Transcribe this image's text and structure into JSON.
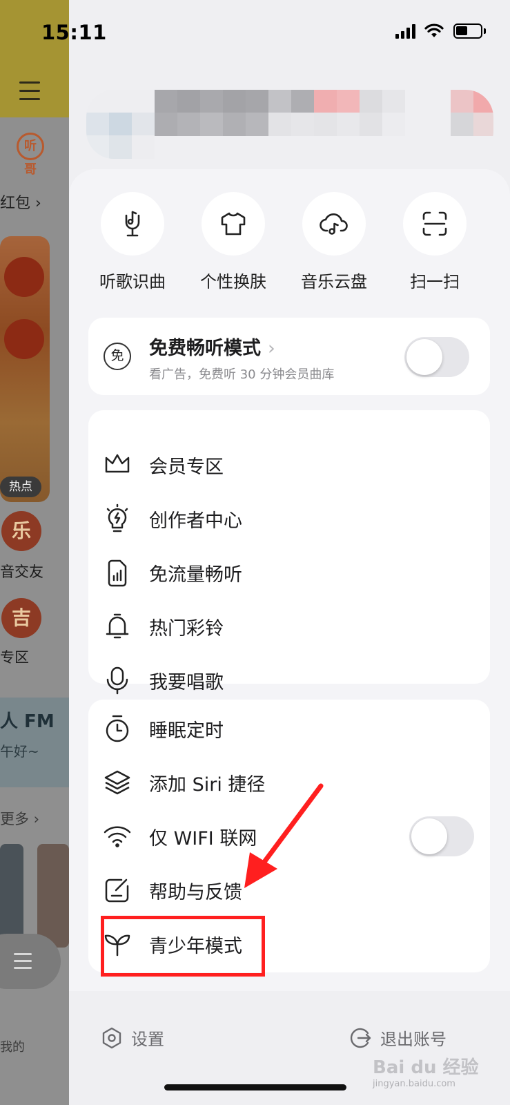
{
  "status_bar": {
    "time": "15:11"
  },
  "background_app": {
    "logo": "听哥",
    "red_packet": "红包",
    "hot_badge": "热点",
    "circle1": "乐",
    "label1": "音交友",
    "circle2": "吉",
    "label2": "专区",
    "fm_title": "人 FM",
    "fm_sub": "午好~",
    "more": "更多",
    "mine": "我的"
  },
  "quick_actions": [
    {
      "label": "听歌识曲",
      "icon": "mic-music-icon"
    },
    {
      "label": "个性换肤",
      "icon": "tshirt-icon"
    },
    {
      "label": "音乐云盘",
      "icon": "cloud-music-icon"
    },
    {
      "label": "扫一扫",
      "icon": "scan-icon"
    }
  ],
  "free_mode": {
    "badge": "免",
    "title": "免费畅听模式",
    "subtitle": "看广告，免费听 30 分钟会员曲库",
    "toggle_on": false
  },
  "menu_group1": [
    {
      "label": "会员专区",
      "icon": "crown-icon"
    },
    {
      "label": "创作者中心",
      "icon": "bulb-icon"
    },
    {
      "label": "免流量畅听",
      "icon": "sim-card-icon"
    },
    {
      "label": "热门彩铃",
      "icon": "bell-icon"
    },
    {
      "label": "我要唱歌",
      "icon": "microphone-icon"
    }
  ],
  "menu_group2": [
    {
      "label": "睡眠定时",
      "icon": "timer-icon"
    },
    {
      "label": "添加 Siri 捷径",
      "icon": "layers-icon"
    },
    {
      "label": "仅 WIFI 联网",
      "icon": "wifi-icon",
      "toggle_on": false
    },
    {
      "label": "帮助与反馈",
      "icon": "feedback-icon"
    },
    {
      "label": "青少年模式",
      "icon": "sprout-icon"
    }
  ],
  "bottom_bar": {
    "settings": "设置",
    "logout": "退出账号"
  },
  "watermark": {
    "brand": "Bai du 经验",
    "url": "jingyan.baidu.com"
  },
  "colors": {
    "highlight": "#ff1f1f",
    "panel": "#f4f4f7",
    "card": "#ffffff"
  }
}
